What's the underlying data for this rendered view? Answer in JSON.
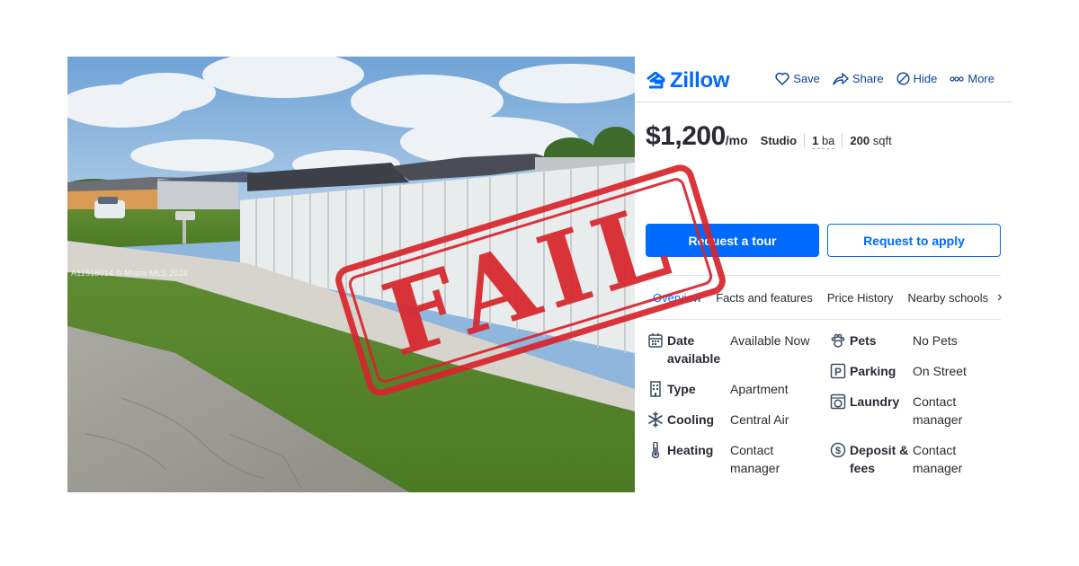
{
  "photo": {
    "watermark": "A11515014 © Miami MLS 2024"
  },
  "stamp": {
    "text": "FAIL"
  },
  "header": {
    "logo_text": "Zillow",
    "actions": [
      {
        "label": "Save",
        "icon": "heart-icon"
      },
      {
        "label": "Share",
        "icon": "share-icon"
      },
      {
        "label": "Hide",
        "icon": "hide-icon"
      },
      {
        "label": "More",
        "icon": "more-icon"
      }
    ]
  },
  "listing": {
    "price": "$1,200",
    "per": "/mo",
    "beds": "Studio",
    "baths_value": "1",
    "baths_unit": "ba",
    "sqft_value": "200",
    "sqft_unit": "sqft"
  },
  "buttons": {
    "tour": "Request a tour",
    "apply": "Request to apply"
  },
  "tabs": [
    "Overview",
    "Facts and features",
    "Price History",
    "Nearby schools"
  ],
  "facts": {
    "left": [
      {
        "label": "Date available",
        "value": "Available Now",
        "icon": "calendar-icon"
      },
      {
        "label": "Type",
        "value": "Apartment",
        "icon": "building-icon"
      },
      {
        "label": "Cooling",
        "value": "Central Air",
        "icon": "snowflake-icon"
      },
      {
        "label": "Heating",
        "value": "Contact manager",
        "icon": "thermometer-icon"
      }
    ],
    "right": [
      {
        "label": "Pets",
        "value": "No Pets",
        "icon": "paw-icon"
      },
      {
        "label": "Parking",
        "value": "On Street",
        "icon": "parking-icon"
      },
      {
        "label": "Laundry",
        "value": "Contact manager",
        "icon": "washer-icon"
      },
      {
        "label": "Deposit & fees",
        "value": "Contact manager",
        "icon": "deposit-icon"
      }
    ]
  },
  "colors": {
    "brand": "#006aff",
    "action_text": "#0d4599",
    "stamp": "#d8242b"
  }
}
